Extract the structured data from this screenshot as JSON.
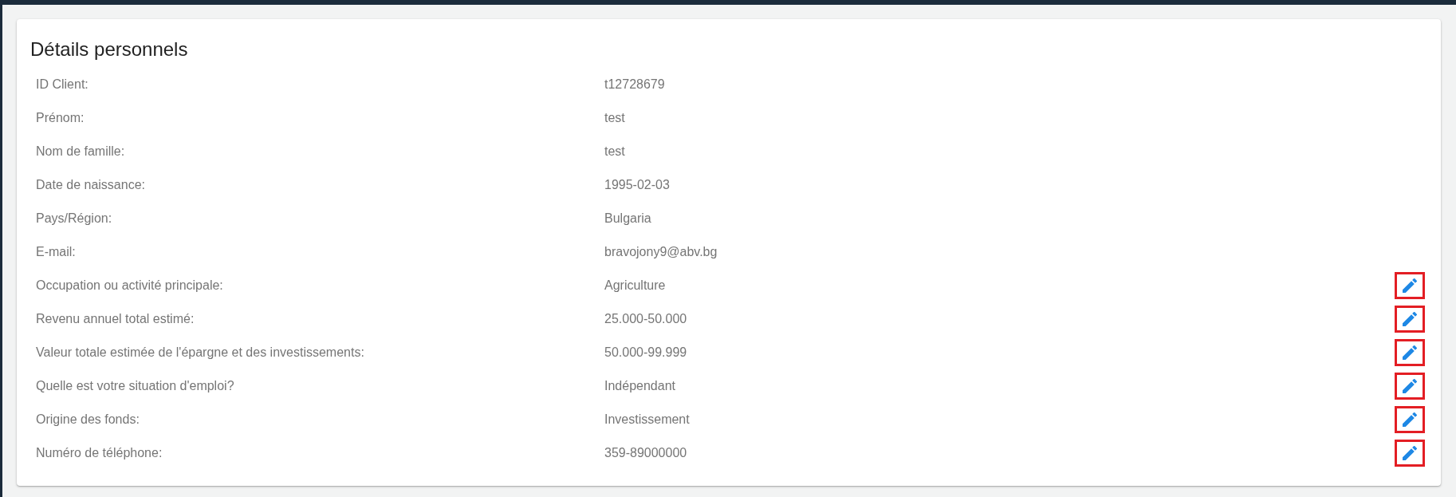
{
  "card": {
    "title": "Détails personnels",
    "rows": [
      {
        "label": "ID Client:",
        "value": "t12728679"
      },
      {
        "label": "Prénom:",
        "value": "test"
      },
      {
        "label": "Nom de famille:",
        "value": "test"
      },
      {
        "label": "Date de naissance:",
        "value": "1995-02-03"
      },
      {
        "label": "Pays/Région:",
        "value": "Bulgaria"
      },
      {
        "label": "E-mail:",
        "value": "bravojony9@abv.bg"
      },
      {
        "label": "Occupation ou activité principale:",
        "value": "Agriculture",
        "edit_button": {
          "highlighted": true
        }
      },
      {
        "label": "Revenu annuel total estimé:",
        "value": "25.000-50.000",
        "edit_button": {
          "highlighted": true
        }
      },
      {
        "label": "Valeur totale estimée de l'épargne et des investissements:",
        "value": "50.000-99.999",
        "edit_button": {
          "highlighted": true
        }
      },
      {
        "label": "Quelle est votre situation d'emploi?",
        "value": "Indépendant",
        "edit_button": {
          "highlighted": true
        }
      },
      {
        "label": "Origine des fonds:",
        "value": "Investissement",
        "edit_button": {
          "highlighted": true
        }
      },
      {
        "label": "Numéro de téléphone:",
        "value": "359-89000000",
        "edit_button": {
          "highlighted": true
        }
      }
    ]
  }
}
